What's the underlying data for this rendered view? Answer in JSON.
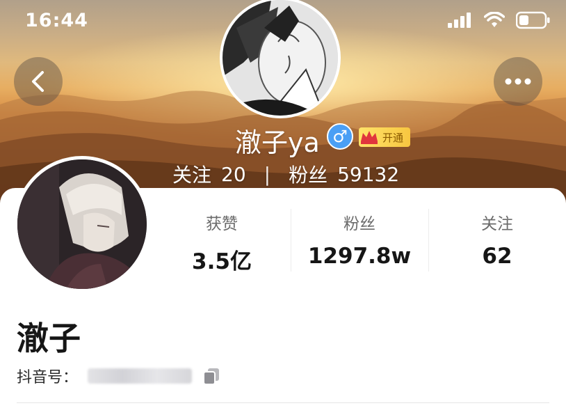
{
  "status_bar": {
    "time": "16:44",
    "icons": [
      "signal-icon",
      "wifi-icon",
      "battery-icon"
    ]
  },
  "header": {
    "back_icon": "chevron-left-icon",
    "more_icon": "more-dots-icon",
    "display_name": "澈子ya",
    "gender_symbol": "♂",
    "vip_label": "开通",
    "following_label": "关注",
    "following_count": "20",
    "separator": "|",
    "followers_label": "粉丝",
    "followers_count": "59132"
  },
  "profile": {
    "stats": [
      {
        "label": "获赞",
        "value": "3.5亿"
      },
      {
        "label": "粉丝",
        "value": "1297.8w"
      },
      {
        "label": "关注",
        "value": "62"
      }
    ],
    "name": "澈子",
    "id_label": "抖音号：",
    "id_value": "",
    "copy_icon": "copy-icon"
  },
  "colors": {
    "gender_badge": "#4a9ff5",
    "vip_badge": "#f7c640",
    "vip_text": "#8a5a00"
  }
}
